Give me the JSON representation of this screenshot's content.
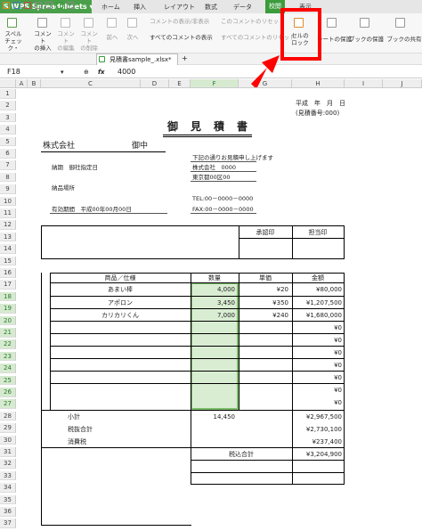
{
  "app": {
    "title": "WPS Spreadsheets"
  },
  "tabs": [
    "ホーム",
    "挿入",
    "レイアウト",
    "数式",
    "データ",
    "校閲",
    "表示"
  ],
  "ribbon": {
    "spell": "スペル\nチェック・",
    "comment_insert": "コメント\nの挿入",
    "comment_edit": "コメント\nの編集",
    "comment_delete": "コメント\nの削除",
    "prev": "前へ",
    "next": "次へ",
    "show_hide": "コメントの表示/非表示",
    "show_all": "すべてのコメントの表示",
    "reset": "このコメントのリセット",
    "reset_all": "すべてのコメントのリセット",
    "cell_lock": "セルの\nロック",
    "sheet_protect": "シートの保護",
    "book_protect": "ブックの保護",
    "book_share": "ブックの共有"
  },
  "doc_tab": "見積書sample_.xlsx*",
  "formula": {
    "cell": "F18",
    "fx": "fx",
    "value": "4000"
  },
  "columns": [
    "A",
    "B",
    "C",
    "D",
    "E",
    "F",
    "G",
    "H",
    "I",
    "J"
  ],
  "rows": [
    "1",
    "2",
    "3",
    "4",
    "5",
    "6",
    "7",
    "8",
    "9",
    "10",
    "11",
    "12",
    "13",
    "14",
    "15",
    "16",
    "17",
    "18",
    "19",
    "20",
    "21",
    "22",
    "23",
    "24",
    "25",
    "26",
    "27",
    "28",
    "29",
    "30",
    "31",
    "32",
    "33",
    "34",
    "35",
    "36",
    "37"
  ],
  "sheet": {
    "date_line": "平成　年　月　日",
    "estimate_no": "(見積番号:000)",
    "title": "御　見　積　書",
    "company": "株式会社",
    "onchu": "御中",
    "note": "下記の通りお見積申し上げます",
    "delivery": "納期　御社指定日",
    "our_company": "株式会社　0000",
    "address": "東京都00区00",
    "place": "納品場所",
    "tel": "TEL:00－0000－0000",
    "validity": "有効期間　平成00年00月00日",
    "fax": "FAX:00－0000－0000",
    "approve": "承認印",
    "charge": "担当印",
    "head_item": "商品／仕様",
    "head_qty": "数量",
    "head_price": "単価",
    "head_amount": "金額",
    "items": [
      {
        "name": "あまい棒",
        "qty": "4,000",
        "price": "¥20",
        "amount": "¥80,000"
      },
      {
        "name": "アポロン",
        "qty": "3,450",
        "price": "¥350",
        "amount": "¥1,207,500"
      },
      {
        "name": "カリカリくん",
        "qty": "7,000",
        "price": "¥240",
        "amount": "¥1,680,000"
      }
    ],
    "zero": "¥0",
    "subtotal_label": "小計",
    "subtotal_qty": "14,450",
    "subtotal": "¥2,967,500",
    "taxed_label": "税抜合計",
    "taxed": "¥2,730,100",
    "tax_label": "消費税",
    "tax": "¥237,400",
    "total_label": "税込合計",
    "total": "¥3,204,900"
  },
  "colors": {
    "accent": "#4aa04a",
    "selection": "#d9edd2",
    "highlight": "#ff0000"
  }
}
